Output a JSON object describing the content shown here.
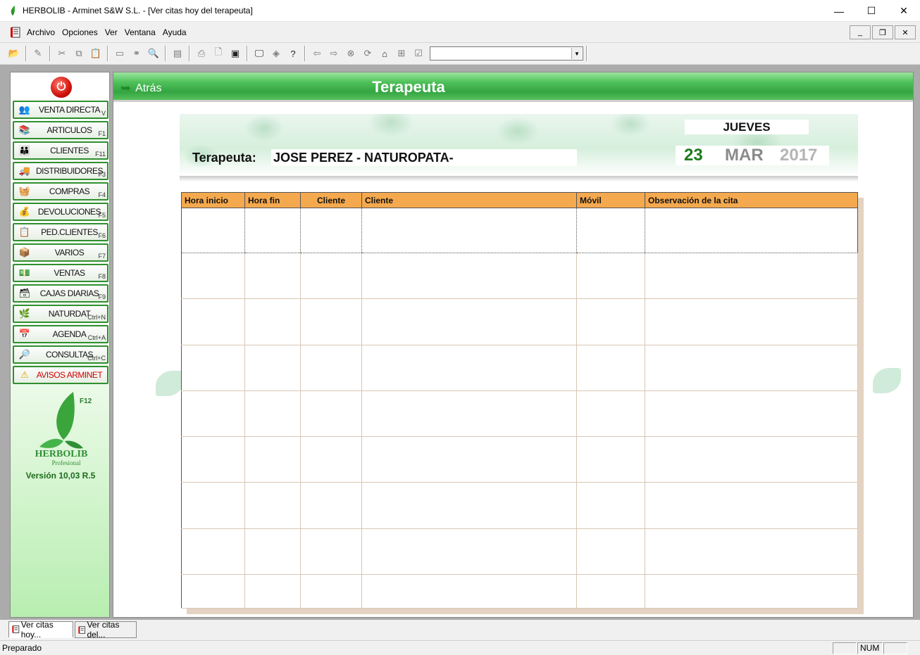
{
  "window": {
    "title": "HERBOLIB - Arminet S&W S.L. - [Ver citas hoy del terapeuta]",
    "minimize": "—",
    "maximize": "☐",
    "close": "✕"
  },
  "menu": {
    "items": [
      "Archivo",
      "Opciones",
      "Ver",
      "Ventana",
      "Ayuda"
    ]
  },
  "sidebar": {
    "items": [
      {
        "label": "VENTA DIRECTA",
        "key": "V",
        "icon": "people-icon"
      },
      {
        "label": "ARTICULOS",
        "key": "F1",
        "icon": "boxes-icon"
      },
      {
        "label": "CLIENTES",
        "key": "F11",
        "icon": "clients-icon"
      },
      {
        "label": "DISTRIBUIDORES",
        "key": "F3",
        "icon": "truck-icon"
      },
      {
        "label": "COMPRAS",
        "key": "F4",
        "icon": "basket-icon"
      },
      {
        "label": "DEVOLUCIONES",
        "key": "F5",
        "icon": "return-icon"
      },
      {
        "label": "PED.CLIENTES",
        "key": "F6",
        "icon": "clipboard-icon"
      },
      {
        "label": "VARIOS",
        "key": "F7",
        "icon": "box-icon"
      },
      {
        "label": "VENTAS",
        "key": "F8",
        "icon": "sales-icon"
      },
      {
        "label": "CAJAS DIARIAS",
        "key": "F9",
        "icon": "cashbox-icon"
      },
      {
        "label": "NATURDAT",
        "key": "Ctrl+N",
        "icon": "plant-icon"
      },
      {
        "label": "AGENDA",
        "key": "Ctrl+A",
        "icon": "calendar-icon"
      },
      {
        "label": "CONSULTAS",
        "key": "Ctrl+C",
        "icon": "magnifier-icon"
      },
      {
        "label": "AVISOS ARMINET",
        "key": "",
        "icon": "warning-icon"
      }
    ],
    "f12": "F12",
    "logo_text": "HERBOLIB",
    "logo_sub": "Profesional",
    "version": "Versión 10,03 R.5"
  },
  "header": {
    "back_label": "Atrás",
    "title": "Terapeuta"
  },
  "therapist": {
    "label": "Terapeuta:",
    "name": "JOSE PEREZ - NATUROPATA-"
  },
  "date": {
    "weekday": "JUEVES",
    "day": "23",
    "month": "MAR",
    "year": "2017"
  },
  "table": {
    "columns": [
      "Hora inicio",
      "Hora fin",
      "Cliente",
      "Cliente",
      "Móvil",
      "Observación de la cita"
    ]
  },
  "tabs": [
    {
      "label": "Ver citas hoy..."
    },
    {
      "label": "Ver citas del..."
    }
  ],
  "status": {
    "text": "Preparado",
    "num": "NUM"
  }
}
